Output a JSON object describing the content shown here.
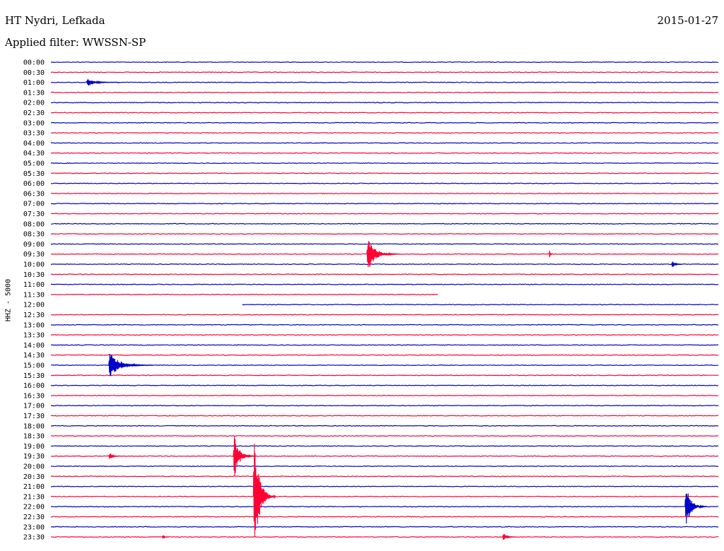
{
  "header": {
    "station": "HT Nydri, Lefkada",
    "date": "2015-01-27",
    "filter": "Applied filter: WWSSN-SP",
    "channel_label": "HHZ - 5000"
  },
  "colors": {
    "blue": "#0000cc",
    "red": "#ff0033",
    "text": "#000000",
    "background": "#ffffff"
  },
  "chart_data": {
    "type": "line",
    "title": "HT Nydri, Lefkada",
    "subtitle": "Applied filter: WWSSN-SP",
    "ylabel": "HHZ - 5000",
    "row_labels": [
      "00:00",
      "00:30",
      "01:00",
      "01:30",
      "02:00",
      "02:30",
      "03:00",
      "03:30",
      "04:00",
      "04:30",
      "05:00",
      "05:30",
      "06:00",
      "06:30",
      "07:00",
      "07:30",
      "08:00",
      "08:30",
      "09:00",
      "09:30",
      "10:00",
      "10:30",
      "11:00",
      "11:30",
      "12:00",
      "12:30",
      "13:00",
      "13:30",
      "14:00",
      "14:30",
      "15:00",
      "15:30",
      "16:00",
      "16:30",
      "17:00",
      "17:30",
      "18:00",
      "18:30",
      "19:00",
      "19:30",
      "20:00",
      "20:30",
      "21:00",
      "21:30",
      "22:00",
      "22:30",
      "23:00",
      "23:30"
    ],
    "row_colors": [
      "blue",
      "red",
      "blue",
      "red",
      "blue",
      "red",
      "blue",
      "red",
      "blue",
      "red",
      "blue",
      "red",
      "blue",
      "red",
      "blue",
      "red",
      "blue",
      "red",
      "blue",
      "red",
      "blue",
      "red",
      "blue",
      "red",
      "blue",
      "red",
      "blue",
      "red",
      "blue",
      "red",
      "blue",
      "red",
      "blue",
      "red",
      "blue",
      "red",
      "blue",
      "red",
      "blue",
      "red",
      "blue",
      "red",
      "blue",
      "red",
      "blue",
      "red",
      "blue",
      "red"
    ],
    "x_unit": "minutes within 30-minute row",
    "x_range": [
      0,
      30
    ],
    "data_gaps": [
      {
        "row": "11:30",
        "from_min": 17.4,
        "to_min": 30
      },
      {
        "row": "12:00",
        "from_min": 0,
        "to_min": 8.6
      }
    ],
    "events": [
      {
        "row": "01:00",
        "minute": 1.6,
        "amplitude": 0.5,
        "duration_min": 1.5
      },
      {
        "row": "09:30",
        "minute": 14.2,
        "amplitude": 2.2,
        "duration_min": 1.5
      },
      {
        "row": "09:30",
        "minute": 22.4,
        "amplitude": 1.0,
        "duration_min": 0.1
      },
      {
        "row": "10:00",
        "minute": 27.9,
        "amplitude": 0.6,
        "duration_min": 0.5
      },
      {
        "row": "15:00",
        "minute": 2.6,
        "amplitude": 1.6,
        "duration_min": 2.0
      },
      {
        "row": "19:30",
        "minute": 2.6,
        "amplitude": 0.7,
        "duration_min": 0.5
      },
      {
        "row": "19:30",
        "minute": 8.2,
        "amplitude": 3.0,
        "duration_min": 1.0
      },
      {
        "row": "21:30",
        "minute": 9.1,
        "amplitude": 9.0,
        "duration_min": 1.0
      },
      {
        "row": "22:00",
        "minute": 28.5,
        "amplitude": 3.0,
        "duration_min": 1.0
      },
      {
        "row": "23:30",
        "minute": 5.0,
        "amplitude": 0.4,
        "duration_min": 0.3
      },
      {
        "row": "23:30",
        "minute": 20.3,
        "amplitude": 0.7,
        "duration_min": 0.6
      }
    ]
  }
}
